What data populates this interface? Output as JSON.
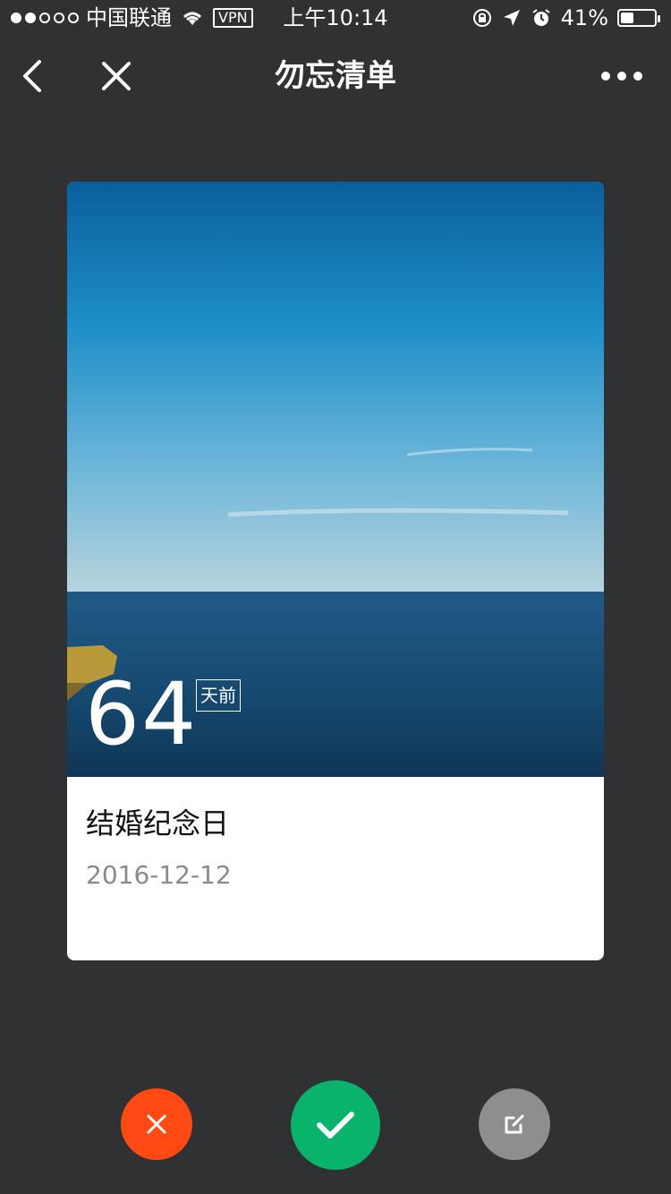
{
  "status_bar": {
    "carrier": "中国联通",
    "vpn": "VPN",
    "time": "上午10:14",
    "battery_percent_text": "41%",
    "battery_level": 0.41
  },
  "nav": {
    "title": "勿忘清单",
    "back_icon": "chevron-left-icon",
    "close_icon": "close-icon",
    "more_icon": "more-icon"
  },
  "card": {
    "days_count": "64",
    "days_suffix": "天前",
    "title": "结婚纪念日",
    "date": "2016-12-12",
    "image_subject": "sea-horizon"
  },
  "actions": {
    "delete_icon": "close-icon",
    "done_icon": "check-icon",
    "edit_icon": "edit-icon",
    "colors": {
      "delete": "#ff4a14",
      "done": "#09b36b",
      "edit": "#8e8e8e"
    }
  },
  "colors": {
    "background": "#2f3133",
    "card": "#ffffff",
    "date_text": "#8a8a8a"
  }
}
